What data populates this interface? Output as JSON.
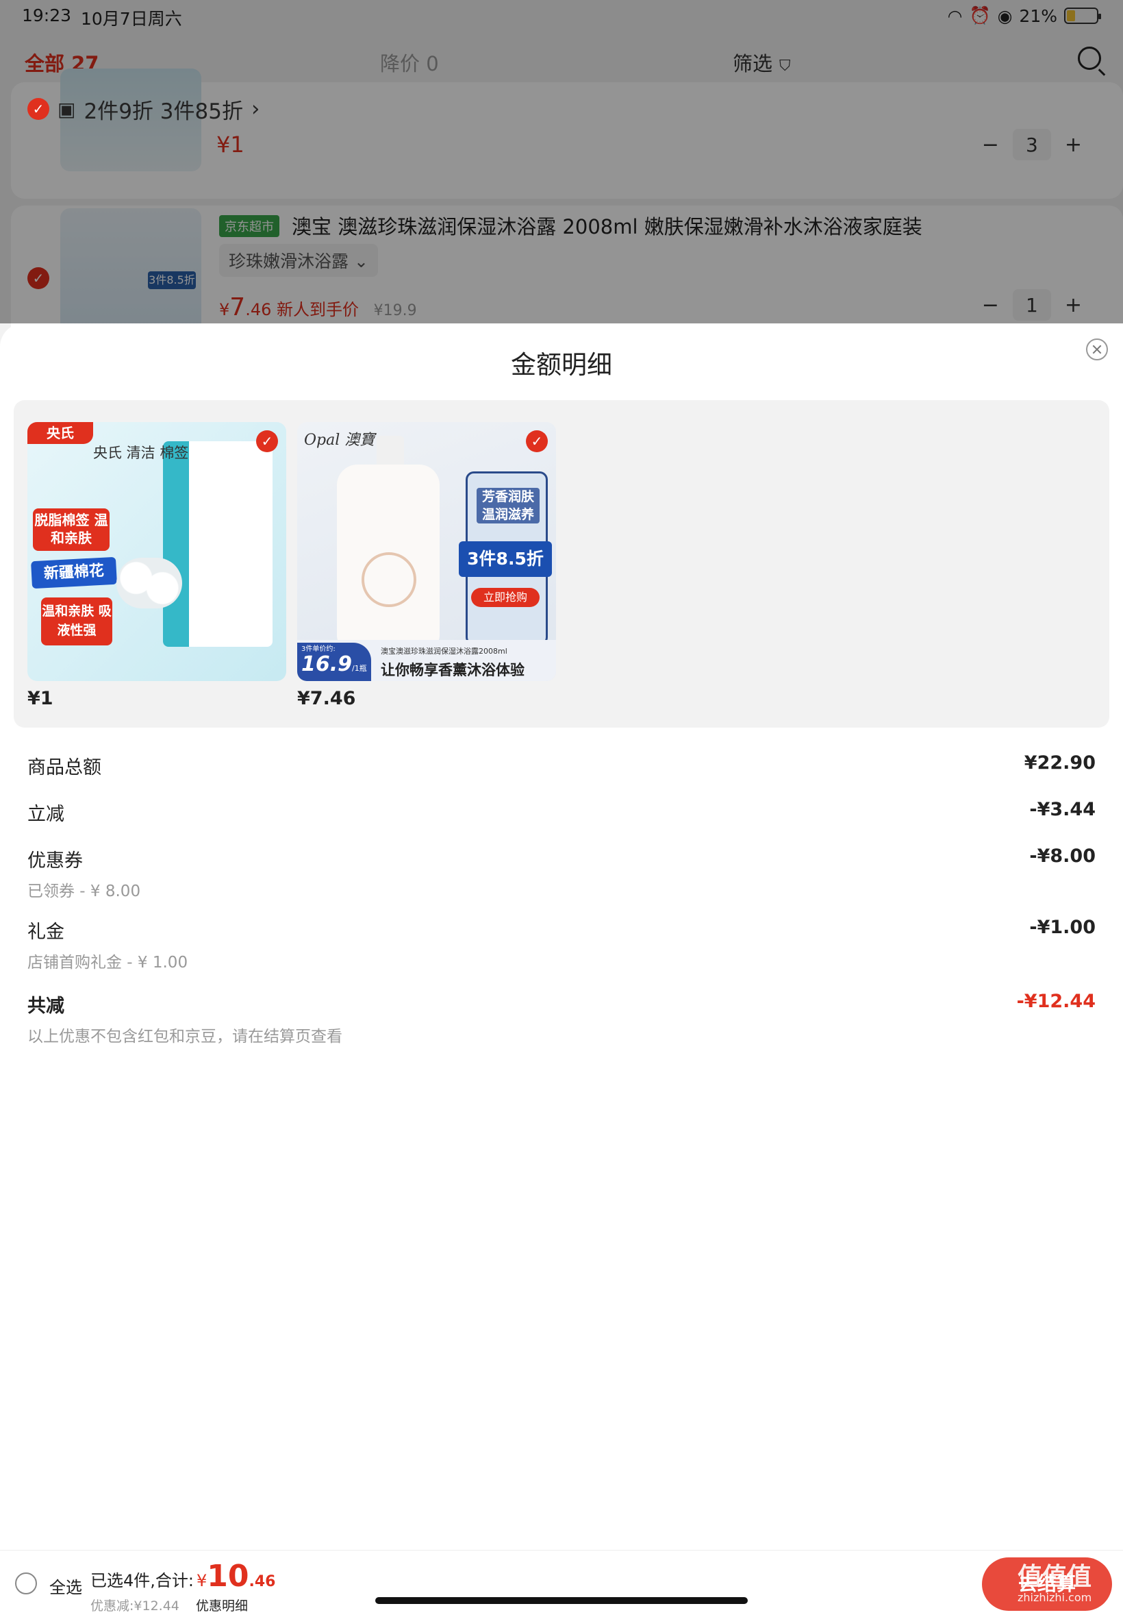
{
  "status_bar": {
    "time": "19:23",
    "date": "10月7日周六",
    "battery": "21%"
  },
  "cart_tabs": {
    "all": "全部 27",
    "price_drop": "降价 0",
    "filter": "筛选"
  },
  "cart_background": {
    "promo_label": "2件9折 3件85折",
    "promo_arrow": "›",
    "item1_price": "¥1",
    "item1_qty": "3",
    "item2_tag": "京东超市",
    "item2_title": "澳宝 澳滋珍珠滋润保湿沐浴露 2008ml 嫩肤保湿嫩滑补水沐浴液家庭装",
    "item2_spec": "珍珠嫩滑沐浴露 ⌄",
    "item2_price_symbol": "¥",
    "item2_price_int": "7",
    "item2_price_dec": ".46",
    "item2_price_note": "新人到手价",
    "item2_orig_price": "¥19.9",
    "item2_qty": "1",
    "item2_thumb_badge": "3件8.5折",
    "minus": "−",
    "plus": "+"
  },
  "sheet": {
    "title": "金额明细",
    "products": [
      {
        "price": "¥1",
        "image_text": {
          "brand": "央氏",
          "badge1": "脱脂棉签 温和亲肤",
          "badge2": "新疆棉花",
          "badge3": "温和亲肤 吸液性强",
          "bag": "央氏 清洁 棉签"
        }
      },
      {
        "price": "¥7.46",
        "image_text": {
          "brand": "Opal 澳寶",
          "panel": "芳香润肤 温润滋养",
          "offer": "3件8.5折",
          "button": "立即抢购",
          "unit_label": "3件单价约:",
          "unit_price": "16.9",
          "unit_per": "/1瓶",
          "line1": "澳宝澳滋珍珠滋润保湿沐浴露2008ml",
          "line2": "让你畅享香薰沐浴体验"
        }
      }
    ],
    "rows": {
      "subtotal": {
        "label": "商品总额",
        "value": "¥22.90"
      },
      "instant": {
        "label": "立减",
        "value": "-¥3.44"
      },
      "coupon": {
        "label": "优惠券",
        "sub": "已领券 - ¥ 8.00",
        "value": "-¥8.00"
      },
      "gift": {
        "label": "礼金",
        "sub": "店铺首购礼金 - ¥ 1.00",
        "value": "-¥1.00"
      },
      "total": {
        "label": "共减",
        "sub": "以上优惠不包含红包和京豆，请在结算页查看",
        "value": "-¥12.44"
      }
    }
  },
  "bottom_bar": {
    "select_all": "全选",
    "summary_prefix": "已选4件,合计:",
    "currency": "¥",
    "total_int": "10",
    "total_dec": ".46",
    "discount": "优惠减:¥12.44",
    "detail_link": "优惠明细",
    "checkout": "去结算"
  },
  "watermark": {
    "main": "值值值",
    "sub": "zhizhizhi.com"
  },
  "colors": {
    "accent_red": "#e0301e",
    "sheet_bg": "#ffffff",
    "strip_bg": "#f2f2f2"
  }
}
